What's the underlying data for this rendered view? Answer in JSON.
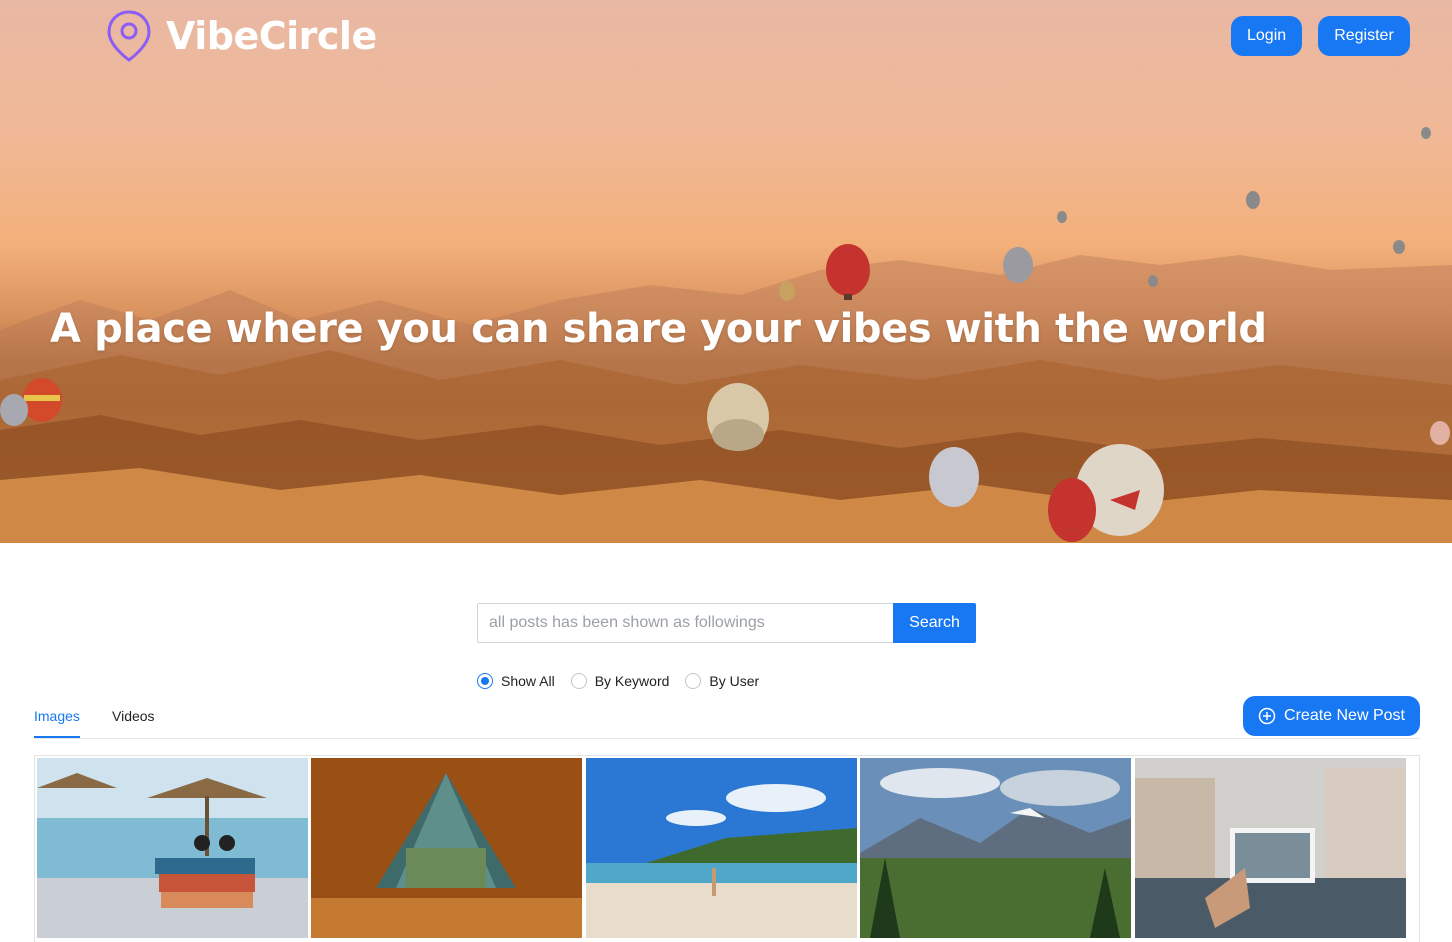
{
  "header": {
    "brand": "VibeCircle",
    "login_label": "Login",
    "register_label": "Register"
  },
  "hero": {
    "tagline": "A place where you can share your vibes with the world"
  },
  "search": {
    "placeholder": "all posts has been shown as followings",
    "button_label": "Search",
    "options": [
      "Show All",
      "By Keyword",
      "By User"
    ],
    "selected": "Show All"
  },
  "tabs": {
    "items": [
      "Images",
      "Videos"
    ],
    "active": "Images",
    "create_label": "Create New Post"
  },
  "gallery": {
    "images": [
      {
        "subject": "beach umbrellas with books and sunglasses"
      },
      {
        "subject": "view from inside a tent to the forest"
      },
      {
        "subject": "person doing handstand on a tropical beach"
      },
      {
        "subject": "mountain valley with pine forest"
      },
      {
        "subject": "hand holding photo over a canal"
      }
    ]
  },
  "colors": {
    "accent": "#1877f2",
    "brand_pin": "#8b5cf6"
  },
  "icons": {
    "brand": "location-pin-icon",
    "create": "plus-circle-icon"
  }
}
